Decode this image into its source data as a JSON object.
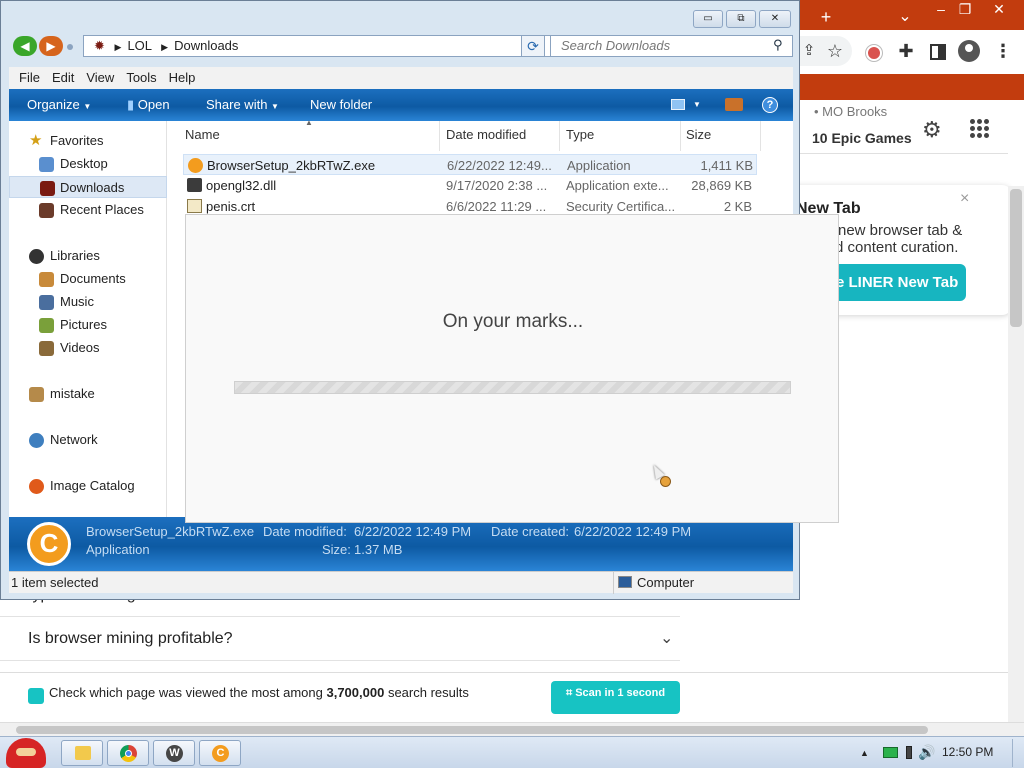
{
  "chrome": {
    "new_tab_symbol": "+",
    "minimize_symbol": "–",
    "restore_symbol": "❐",
    "close_symbol": "✕",
    "tab_list_symbol": "⌄",
    "list_item_partial": "• MO Brooks",
    "list_item_games": "10 Epic Games",
    "liner_title": "New Tab",
    "liner_line1": "new browser tab &",
    "liner_line2": "d content curation.",
    "liner_button": "e LINER New Tab",
    "liner_close": "×",
    "faq_partial": "types of mining",
    "faq_question": "Is browser mining profitable?",
    "scan_message_prefix": "Check which page was viewed the most among ",
    "scan_message_count": "3,700,000",
    "scan_message_suffix": " search results",
    "scan_button": "Scan in 1 second",
    "colors": {
      "frame": "#c23c0e",
      "liner_accent": "#17b5c0"
    }
  },
  "explorer": {
    "title_buttons": {
      "minimize": "▭",
      "maximize": "⧉",
      "close": "✕"
    },
    "breadcrumb": [
      "LOL",
      "Downloads"
    ],
    "search_placeholder": "Search Downloads",
    "menu": [
      "File",
      "Edit",
      "View",
      "Tools",
      "Help"
    ],
    "commands": {
      "organize": "Organize",
      "open": "Open",
      "share_with": "Share with",
      "new_folder": "New folder"
    },
    "nav": {
      "favorites": "Favorites",
      "desktop": "Desktop",
      "downloads": "Downloads",
      "recent_places": "Recent Places",
      "libraries": "Libraries",
      "documents": "Documents",
      "music": "Music",
      "pictures": "Pictures",
      "videos": "Videos",
      "mistake": "mistake",
      "network": "Network",
      "image_catalog": "Image Catalog"
    },
    "columns": {
      "name": "Name",
      "date_modified": "Date modified",
      "type": "Type",
      "size": "Size"
    },
    "files": [
      {
        "name": "BrowserSetup_2kbRTwZ.exe",
        "date": "6/22/2022 12:49...",
        "type": "Application",
        "size": "1,411 KB"
      },
      {
        "name": "opengl32.dll",
        "date": "9/17/2020 2:38 ...",
        "type": "Application exte...",
        "size": "28,869 KB"
      },
      {
        "name": "penis.crt",
        "date": "6/6/2022 11:29 ...",
        "type": "Security Certifica...",
        "size": "2 KB"
      }
    ],
    "details": {
      "filename": "BrowserSetup_2kbRTwZ.exe",
      "date_modified_label": "Date modified:",
      "date_modified": "6/22/2022 12:49 PM",
      "date_created_label": "Date created:",
      "date_created": "6/22/2022 12:49 PM",
      "type": "Application",
      "size_label": "Size:",
      "size": "1.37 MB"
    },
    "status_selected": "1 item selected",
    "status_location": "Computer"
  },
  "dialog": {
    "message": "On your marks...",
    "progress": 0
  },
  "taskbar": {
    "time": "12:50 PM"
  }
}
